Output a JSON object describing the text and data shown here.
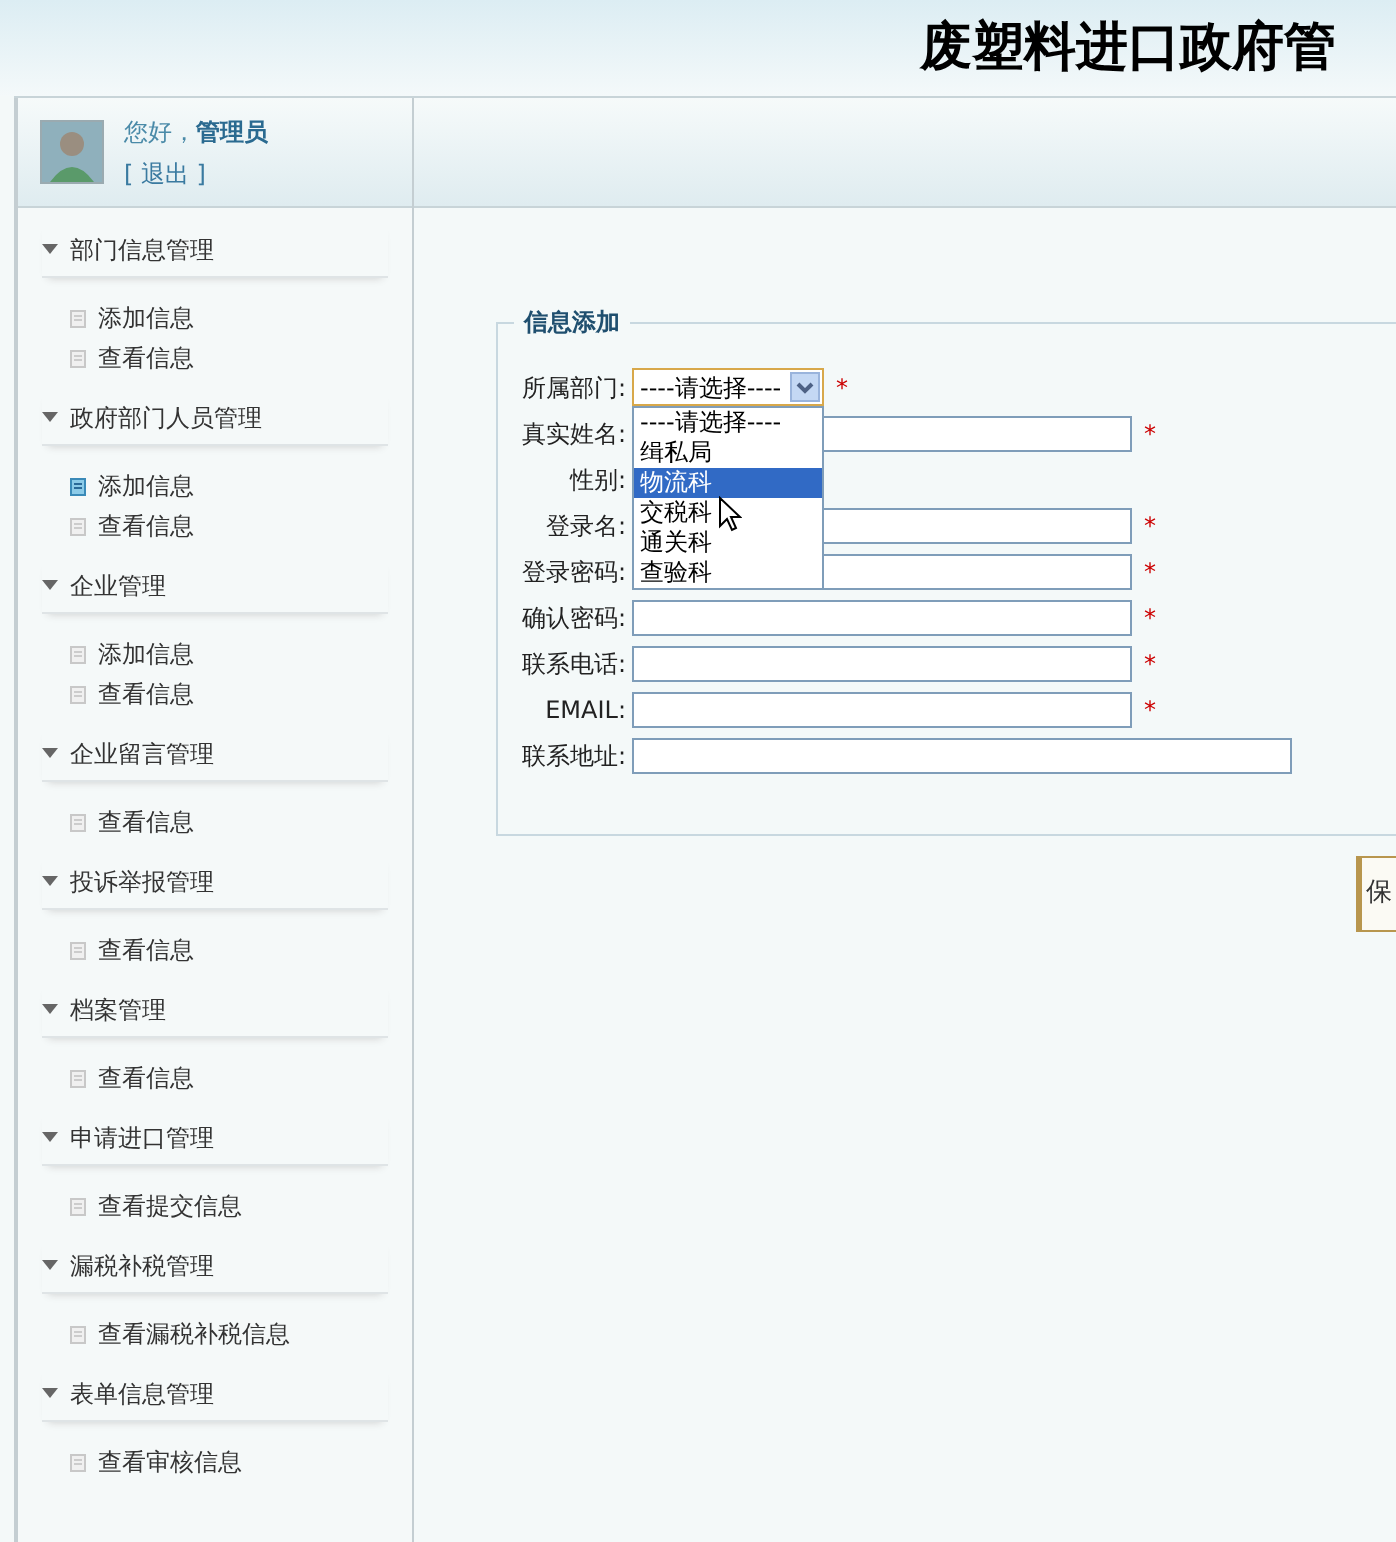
{
  "header": {
    "title": "废塑料进口政府管"
  },
  "user": {
    "greeting": "您好，",
    "name": "管理员",
    "logout": "[ 退出 ]"
  },
  "menu": [
    {
      "title": "部门信息管理",
      "expanded": true,
      "items": [
        {
          "label": "添加信息",
          "selected": false
        },
        {
          "label": "查看信息",
          "selected": false
        }
      ]
    },
    {
      "title": "政府部门人员管理",
      "expanded": true,
      "items": [
        {
          "label": "添加信息",
          "selected": true
        },
        {
          "label": "查看信息",
          "selected": false
        }
      ]
    },
    {
      "title": "企业管理",
      "expanded": true,
      "items": [
        {
          "label": "添加信息",
          "selected": false
        },
        {
          "label": "查看信息",
          "selected": false
        }
      ]
    },
    {
      "title": "企业留言管理",
      "expanded": true,
      "items": [
        {
          "label": "查看信息",
          "selected": false
        }
      ]
    },
    {
      "title": "投诉举报管理",
      "expanded": true,
      "items": [
        {
          "label": "查看信息",
          "selected": false
        }
      ]
    },
    {
      "title": "档案管理",
      "expanded": true,
      "items": [
        {
          "label": "查看信息",
          "selected": false
        }
      ]
    },
    {
      "title": "申请进口管理",
      "expanded": true,
      "items": [
        {
          "label": "查看提交信息",
          "selected": false
        }
      ]
    },
    {
      "title": "漏税补税管理",
      "expanded": true,
      "items": [
        {
          "label": "查看漏税补税信息",
          "selected": false
        }
      ]
    },
    {
      "title": "表单信息管理",
      "expanded": true,
      "items": [
        {
          "label": "查看审核信息",
          "selected": false
        }
      ]
    }
  ],
  "form": {
    "legend": "信息添加",
    "fields": [
      {
        "kind": "select",
        "label": "所属部门:",
        "value": "----请选择----",
        "required_mark": "*",
        "expanded": true,
        "options": [
          {
            "label": "----请选择----",
            "highlighted": false
          },
          {
            "label": "缉私局",
            "highlighted": false
          },
          {
            "label": "物流科",
            "highlighted": true
          },
          {
            "label": "交税科",
            "highlighted": false
          },
          {
            "label": "通关科",
            "highlighted": false
          },
          {
            "label": "查验科",
            "highlighted": false
          }
        ]
      },
      {
        "kind": "text",
        "label": "真实姓名:",
        "required_mark": "*"
      },
      {
        "kind": "hidden",
        "label": "性别:"
      },
      {
        "kind": "text",
        "label": "登录名:",
        "required_mark": "*"
      },
      {
        "kind": "text",
        "label": "登录密码:",
        "required_mark": "*"
      },
      {
        "kind": "text",
        "label": "确认密码:",
        "required_mark": "*"
      },
      {
        "kind": "text",
        "label": "联系电话:",
        "required_mark": "*"
      },
      {
        "kind": "text",
        "label": "EMAIL:",
        "required_mark": "*"
      },
      {
        "kind": "wide",
        "label": "联系地址:"
      }
    ]
  },
  "buttons": [
    {
      "label": "保"
    }
  ]
}
